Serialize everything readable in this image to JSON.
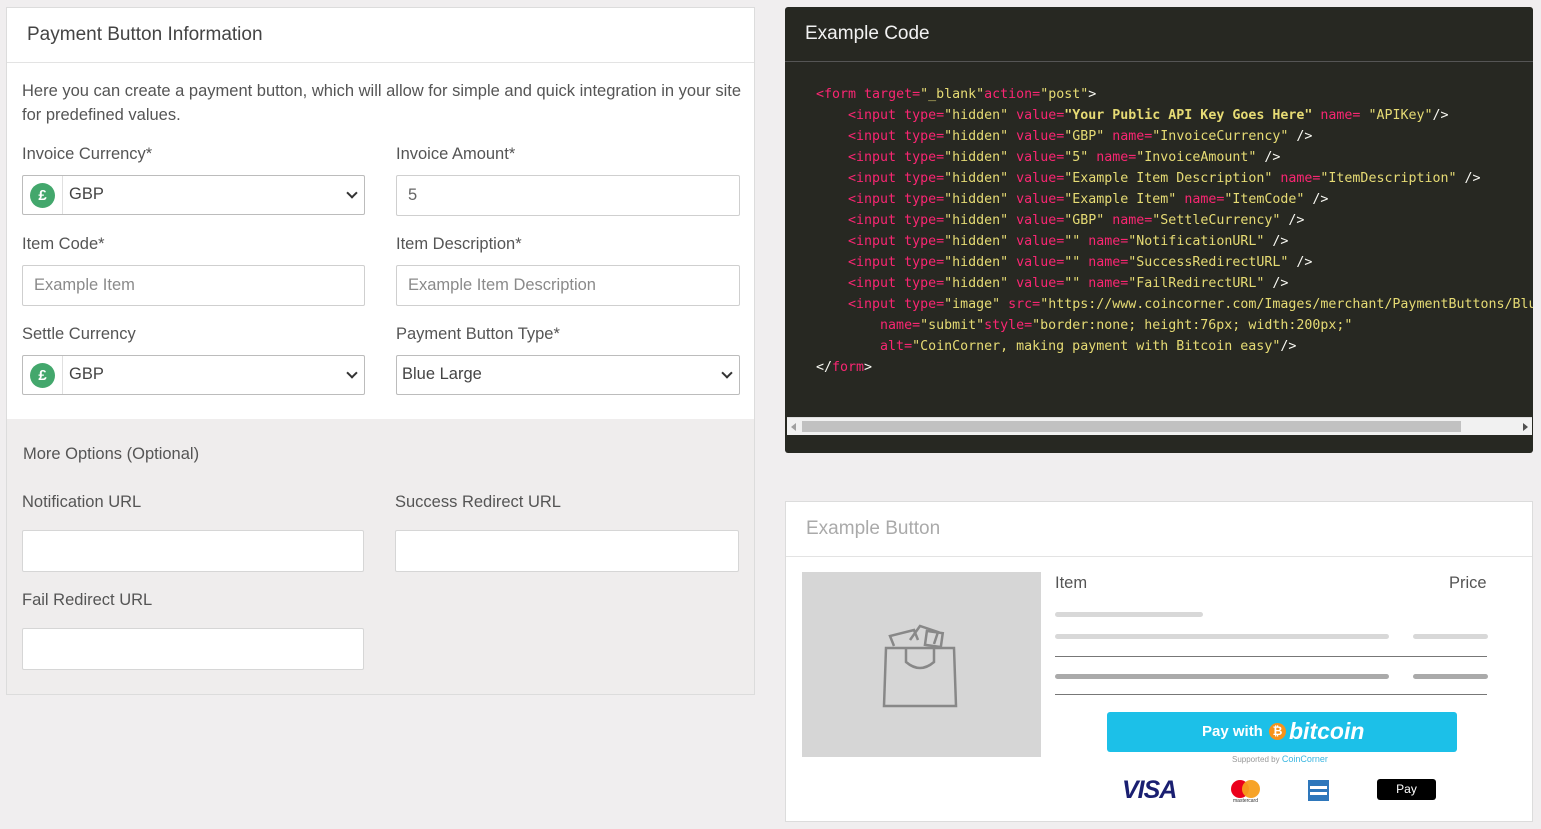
{
  "form": {
    "heading": "Payment Button Information",
    "intro": "Here you can create a payment button, which will allow for simple and quick integration in your site for predefined values.",
    "invoice_currency": {
      "label": "Invoice Currency*",
      "value": "GBP",
      "symbol": "£"
    },
    "invoice_amount": {
      "label": "Invoice Amount*",
      "value": "5"
    },
    "item_code": {
      "label": "Item Code*",
      "placeholder": "Example Item"
    },
    "item_description": {
      "label": "Item Description*",
      "placeholder": "Example Item Description"
    },
    "settle_currency": {
      "label": "Settle Currency",
      "value": "GBP",
      "symbol": "£"
    },
    "button_type": {
      "label": "Payment Button Type*",
      "value": "Blue Large"
    }
  },
  "options": {
    "title": "More Options (Optional)",
    "notification_url": {
      "label": "Notification URL",
      "value": ""
    },
    "success_redirect_url": {
      "label": "Success Redirect URL",
      "value": ""
    },
    "fail_redirect_url": {
      "label": "Fail Redirect URL",
      "value": ""
    }
  },
  "code": {
    "heading": "Example Code",
    "lines": [
      [
        [
          "tag",
          "<form "
        ],
        [
          "attr",
          "target="
        ],
        [
          "str",
          "\"_blank\""
        ],
        [
          "attr",
          "action="
        ],
        [
          "str",
          "\"post\""
        ],
        [
          "pun",
          ">"
        ]
      ],
      [
        [
          "pun",
          "    "
        ],
        [
          "tag",
          "<input "
        ],
        [
          "attr",
          "type="
        ],
        [
          "str",
          "\"hidden\" "
        ],
        [
          "attr",
          "value="
        ],
        [
          "key",
          "\"Your Public API Key Goes Here\" "
        ],
        [
          "attr",
          "name= "
        ],
        [
          "str",
          "\"APIKey\""
        ],
        [
          "pun",
          "/>"
        ]
      ],
      [
        [
          "pun",
          "    "
        ],
        [
          "tag",
          "<input "
        ],
        [
          "attr",
          "type="
        ],
        [
          "str",
          "\"hidden\" "
        ],
        [
          "attr",
          "value="
        ],
        [
          "str",
          "\"GBP\" "
        ],
        [
          "attr",
          "name="
        ],
        [
          "str",
          "\"InvoiceCurrency\" "
        ],
        [
          "pun",
          "/>"
        ]
      ],
      [
        [
          "pun",
          "    "
        ],
        [
          "tag",
          "<input "
        ],
        [
          "attr",
          "type="
        ],
        [
          "str",
          "\"hidden\" "
        ],
        [
          "attr",
          "value="
        ],
        [
          "str",
          "\"5\" "
        ],
        [
          "attr",
          "name="
        ],
        [
          "str",
          "\"InvoiceAmount\" "
        ],
        [
          "pun",
          "/>"
        ]
      ],
      [
        [
          "pun",
          "    "
        ],
        [
          "tag",
          "<input "
        ],
        [
          "attr",
          "type="
        ],
        [
          "str",
          "\"hidden\" "
        ],
        [
          "attr",
          "value="
        ],
        [
          "str",
          "\"Example Item Description\" "
        ],
        [
          "attr",
          "name="
        ],
        [
          "str",
          "\"ItemDescription\" "
        ],
        [
          "pun",
          "/>"
        ]
      ],
      [
        [
          "pun",
          "    "
        ],
        [
          "tag",
          "<input "
        ],
        [
          "attr",
          "type="
        ],
        [
          "str",
          "\"hidden\" "
        ],
        [
          "attr",
          "value="
        ],
        [
          "str",
          "\"Example Item\" "
        ],
        [
          "attr",
          "name="
        ],
        [
          "str",
          "\"ItemCode\" "
        ],
        [
          "pun",
          "/>"
        ]
      ],
      [
        [
          "pun",
          "    "
        ],
        [
          "tag",
          "<input "
        ],
        [
          "attr",
          "type="
        ],
        [
          "str",
          "\"hidden\" "
        ],
        [
          "attr",
          "value="
        ],
        [
          "str",
          "\"GBP\" "
        ],
        [
          "attr",
          "name="
        ],
        [
          "str",
          "\"SettleCurrency\" "
        ],
        [
          "pun",
          "/>"
        ]
      ],
      [
        [
          "pun",
          "    "
        ],
        [
          "tag",
          "<input "
        ],
        [
          "attr",
          "type="
        ],
        [
          "str",
          "\"hidden\" "
        ],
        [
          "attr",
          "value="
        ],
        [
          "str",
          "\"\" "
        ],
        [
          "attr",
          "name="
        ],
        [
          "str",
          "\"NotificationURL\" "
        ],
        [
          "pun",
          "/>"
        ]
      ],
      [
        [
          "pun",
          "    "
        ],
        [
          "tag",
          "<input "
        ],
        [
          "attr",
          "type="
        ],
        [
          "str",
          "\"hidden\" "
        ],
        [
          "attr",
          "value="
        ],
        [
          "str",
          "\"\" "
        ],
        [
          "attr",
          "name="
        ],
        [
          "str",
          "\"SuccessRedirectURL\" "
        ],
        [
          "pun",
          "/>"
        ]
      ],
      [
        [
          "pun",
          "    "
        ],
        [
          "tag",
          "<input "
        ],
        [
          "attr",
          "type="
        ],
        [
          "str",
          "\"hidden\" "
        ],
        [
          "attr",
          "value="
        ],
        [
          "str",
          "\"\" "
        ],
        [
          "attr",
          "name="
        ],
        [
          "str",
          "\"FailRedirectURL\" "
        ],
        [
          "pun",
          "/>"
        ]
      ],
      [
        [
          "pun",
          "    "
        ],
        [
          "tag",
          "<input "
        ],
        [
          "attr",
          "type="
        ],
        [
          "str",
          "\"image\" "
        ],
        [
          "attr",
          "src="
        ],
        [
          "str",
          "\"https://www.coincorner.com/Images/merchant/PaymentButtons/BlueLa"
        ]
      ],
      [
        [
          "pun",
          "        "
        ],
        [
          "attr",
          "name="
        ],
        [
          "str",
          "\"submit\""
        ],
        [
          "attr",
          "style="
        ],
        [
          "str",
          "\"border:none; height:76px; width:200px;\""
        ]
      ],
      [
        [
          "pun",
          "        "
        ],
        [
          "attr",
          "alt="
        ],
        [
          "str",
          "\"CoinCorner, making payment with Bitcoin easy\""
        ],
        [
          "pun",
          "/>"
        ]
      ],
      [
        [
          "pun",
          "</"
        ],
        [
          "tag",
          "form"
        ],
        [
          "pun",
          ">"
        ]
      ]
    ]
  },
  "example": {
    "heading": "Example Button",
    "col_item": "Item",
    "col_price": "Price",
    "pay_with": "Pay with",
    "bitcoin": "bitcoin",
    "bitcoin_symbol": "₿",
    "supported_by": "Supported by",
    "coincorner": "CoinCorner",
    "visa": "VISA",
    "mastercard": "mastercard",
    "apple_pay": " Pay"
  }
}
